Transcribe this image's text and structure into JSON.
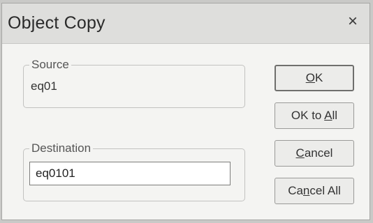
{
  "dialog": {
    "title": "Object Copy",
    "close_glyph": "×"
  },
  "source": {
    "legend": "Source",
    "value": "eq01"
  },
  "destination": {
    "legend": "Destination",
    "value": "eq0101"
  },
  "buttons": {
    "ok": {
      "pre": "",
      "mnemonic": "O",
      "post": "K"
    },
    "ok_to_all": {
      "pre": "OK to ",
      "mnemonic": "A",
      "post": "ll"
    },
    "cancel": {
      "pre": "",
      "mnemonic": "C",
      "post": "ancel"
    },
    "cancel_all": {
      "pre": "Ca",
      "mnemonic": "n",
      "post": "cel All"
    }
  },
  "icons": {
    "close": "close-icon"
  }
}
